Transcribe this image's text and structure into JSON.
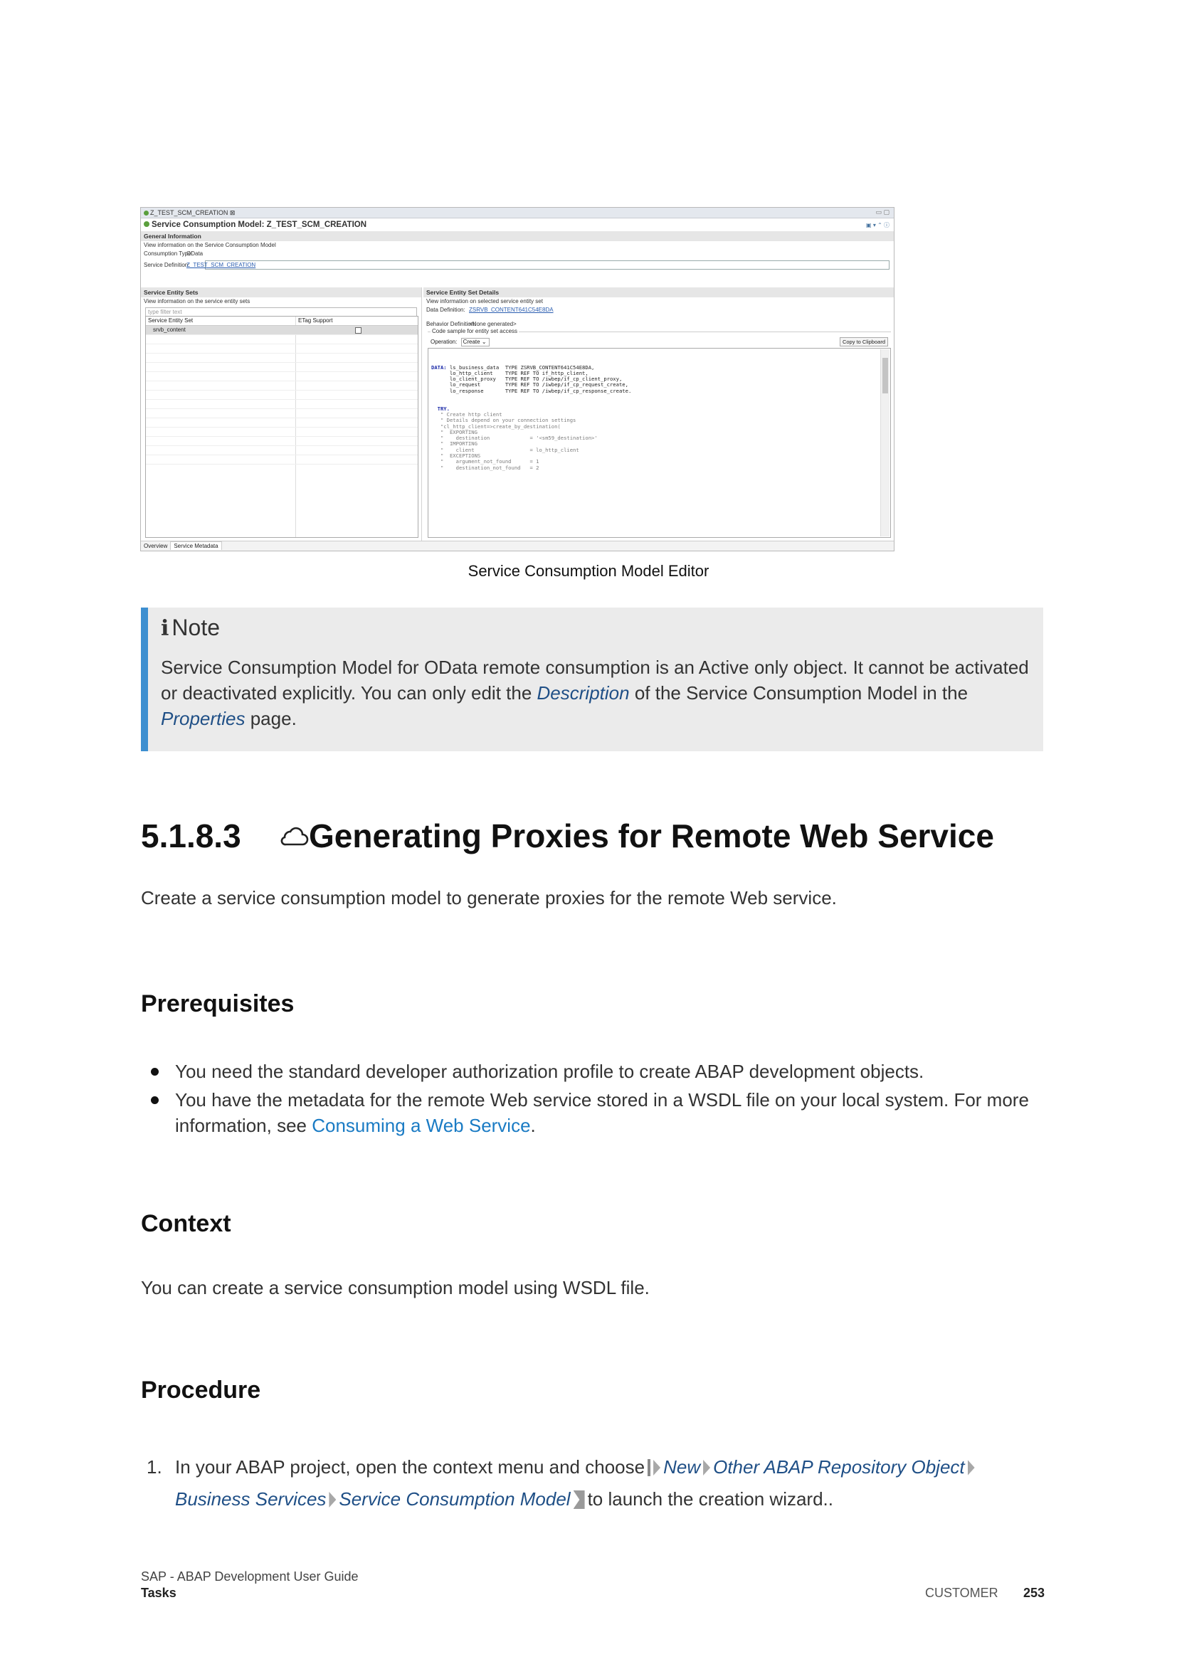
{
  "screenshot": {
    "tab_title": "Z_TEST_SCM_CREATION",
    "tab_close": "⊠",
    "window_controls": "▭ ▢",
    "editor_title": "Service Consumption Model: Z_TEST_SCM_CREATION",
    "editor_tools": "▣ ▾ ⌃ ⓘ",
    "general": {
      "header": "General Information",
      "description": "View information on the Service Consumption Model",
      "consumption_type_label": "Consumption Type:",
      "consumption_type_value": "OData",
      "service_definition_label": "Service Definition:",
      "service_definition_value": "Z_TEST_SCM_CREATION"
    },
    "entity_sets": {
      "header": "Service Entity Sets",
      "description": "View information on the service entity sets",
      "filter_placeholder": "type filter text",
      "col_entity_set": "Service Entity Set",
      "col_etag": "ETag Support",
      "row_entity_set": "srvb_content"
    },
    "details": {
      "header": "Service Entity Set Details",
      "description": "View information on selected service entity set",
      "data_definition_label": "Data Definition:",
      "data_definition_value": "ZSRVB_CONTENT641C54E8DA",
      "behavior_definition_label": "Behavior Definition:",
      "behavior_definition_value": "<None generated>",
      "code_sample_legend": "Code sample for entity set access",
      "operation_label": "Operation:",
      "operation_value": "Create",
      "copy_button": "Copy to Clipboard",
      "code_lines": [
        {
          "kw": "DATA:",
          "text": " ls_business_data  TYPE ZSRVB_CONTENT641C54E8DA,"
        },
        {
          "kw": "",
          "text": "      lo_http_client    TYPE REF TO if_http_client,"
        },
        {
          "kw": "",
          "text": "      lo_client_proxy   TYPE REF TO /iwbep/if_cp_client_proxy,"
        },
        {
          "kw": "",
          "text": "      lo_request        TYPE REF TO /iwbep/if_cp_request_create,"
        },
        {
          "kw": "",
          "text": "      lo_response       TYPE REF TO /iwbep/if_cp_response_create."
        },
        {
          "kw": "",
          "text": ""
        },
        {
          "kw": "",
          "text": ""
        },
        {
          "kw": "  TRY.",
          "text": ""
        },
        {
          "kw": "",
          "text": "   \" Create http client"
        },
        {
          "kw": "",
          "text": "   \" Details depend on your connection settings"
        },
        {
          "kw": "",
          "text": "   \"cl_http_client=>create_by_destination("
        },
        {
          "kw": "",
          "text": "   \"  EXPORTING"
        },
        {
          "kw": "",
          "text": "   \"    destination             = '<sm59_destination>'"
        },
        {
          "kw": "",
          "text": "   \"  IMPORTING"
        },
        {
          "kw": "",
          "text": "   \"    client                  = lo_http_client"
        },
        {
          "kw": "",
          "text": "   \"  EXCEPTIONS"
        },
        {
          "kw": "",
          "text": "   \"    argument_not_found      = 1"
        },
        {
          "kw": "",
          "text": "   \"    destination_not_found   = 2"
        }
      ]
    },
    "bottom_tabs": [
      "Overview",
      "Service Metadata"
    ]
  },
  "caption": "Service Consumption Model Editor",
  "note": {
    "icon": "i",
    "title": "Note",
    "body_1": "Service Consumption Model for OData remote consumption is an Active only object. It cannot be activated or deactivated explicitly. You can only edit the ",
    "link_description": "Description",
    "body_2": " of the Service Consumption Model in the ",
    "link_properties": "Properties",
    "body_3": " page."
  },
  "section": {
    "number": "5.1.8.3",
    "title": "Generating Proxies for Remote Web Service",
    "intro": "Create a service consumption model to generate proxies for the remote Web service."
  },
  "prerequisites": {
    "heading": "Prerequisites",
    "item1": "You need the standard developer authorization profile to create ABAP development objects.",
    "item2_text": "You have the metadata for the remote Web service stored in a WSDL file on your local system. For more information, see ",
    "item2_link": "Consuming a Web Service",
    "item2_end": "."
  },
  "context": {
    "heading": "Context",
    "text": "You can create a service consumption model using WSDL file."
  },
  "procedure": {
    "heading": "Procedure",
    "step_number": "1.",
    "step_text_1": "In your ABAP project, open the context menu and choose",
    "path": [
      "New",
      "Other ABAP Repository Object",
      "Business Services",
      "Service Consumption Model"
    ],
    "step_text_2": "to launch the creation wizard.."
  },
  "footer": {
    "doc_title": "SAP - ABAP Development User Guide",
    "section": "Tasks",
    "classification": "CUSTOMER",
    "page_number": "253"
  }
}
